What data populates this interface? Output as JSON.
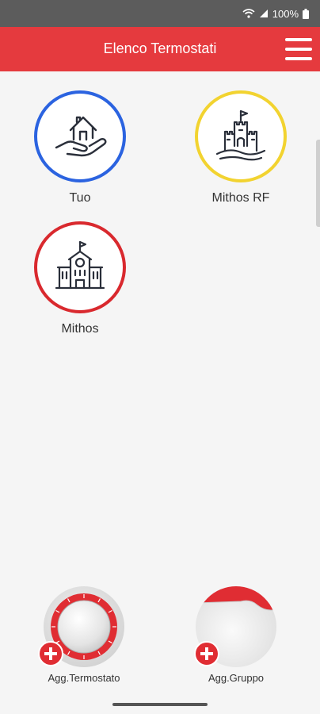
{
  "status_bar": {
    "battery_text": "100%",
    "icons": [
      "wifi-icon",
      "signal-icon",
      "battery-icon"
    ]
  },
  "header": {
    "title": "Elenco Termostati",
    "menu_icon": "hamburger-menu-icon"
  },
  "tiles": [
    {
      "label": "Tuo",
      "ring_color": "#2b63e0",
      "icon": "house-in-hand-icon"
    },
    {
      "label": "Mithos RF",
      "ring_color": "#f2d330",
      "icon": "castle-icon"
    },
    {
      "label": "Mithos",
      "ring_color": "#d9292e",
      "icon": "school-building-icon"
    }
  ],
  "bottom_actions": [
    {
      "label": "Agg.Termostato",
      "icon": "thermostat-dial-icon"
    },
    {
      "label": "Agg.Gruppo",
      "icon": "group-folder-icon"
    }
  ],
  "colors": {
    "header": "#e53a3e",
    "accent_red": "#e02d33",
    "background": "#f5f5f5"
  }
}
